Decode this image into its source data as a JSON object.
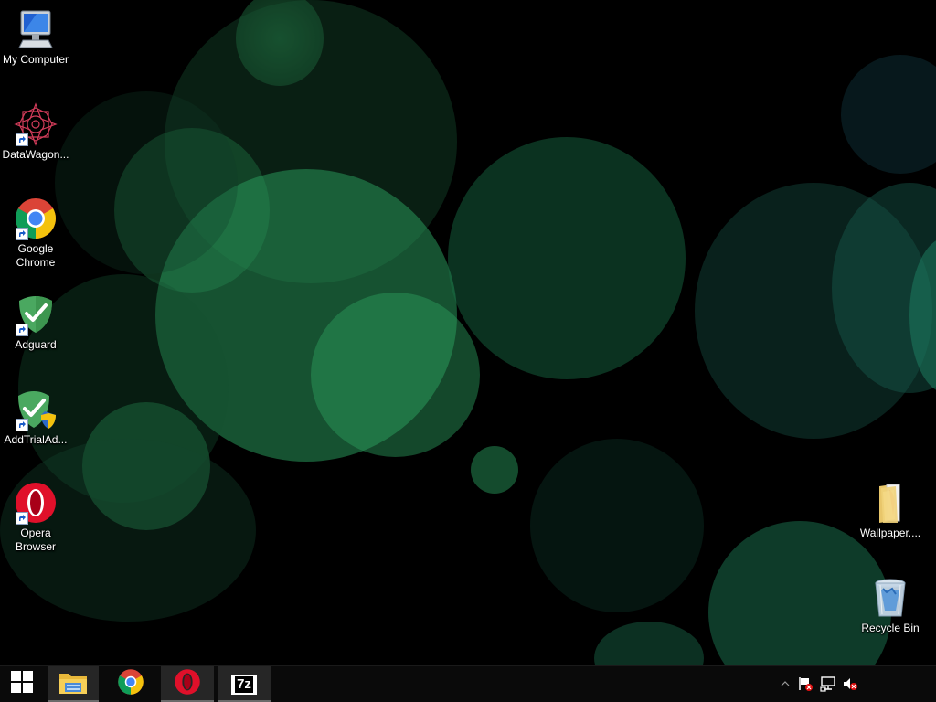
{
  "desktop": {
    "wallpaper": {
      "style": "green bokeh on black",
      "colors": [
        "#1f7a4a",
        "#2a9a5c",
        "#0f4a30",
        "#1a6a5a"
      ]
    },
    "icons_left": [
      {
        "label": "My Computer",
        "icon": "computer-icon",
        "shortcut": false
      },
      {
        "label": "DataWagon...",
        "icon": "datawagon-icon",
        "shortcut": true
      },
      {
        "label": "Google Chrome",
        "icon": "chrome-icon",
        "shortcut": true
      },
      {
        "label": "Adguard",
        "icon": "adguard-icon",
        "shortcut": true
      },
      {
        "label": "AddTrialAd...",
        "icon": "addtrial-icon",
        "shortcut": true
      },
      {
        "label": "Opera Browser",
        "icon": "opera-icon",
        "shortcut": true
      }
    ],
    "icons_right": [
      {
        "label": "Wallpaper....",
        "icon": "folder-icon",
        "shortcut": false
      },
      {
        "label": "Recycle Bin",
        "icon": "recycle-bin-icon",
        "shortcut": false
      }
    ]
  },
  "taskbar": {
    "start": {
      "icon": "windows-start-icon"
    },
    "apps": [
      {
        "icon": "file-explorer-icon",
        "pinned_active": true
      },
      {
        "icon": "chrome-icon",
        "pinned_active": false
      },
      {
        "icon": "opera-icon",
        "pinned_active": true
      },
      {
        "icon": "7zip-icon",
        "pinned_active": true,
        "text": "7z"
      }
    ],
    "tray": [
      {
        "icon": "show-hidden-icons-icon"
      },
      {
        "icon": "action-center-flag-icon"
      },
      {
        "icon": "network-icon"
      },
      {
        "icon": "volume-muted-icon"
      }
    ],
    "accent": "#ff0000"
  }
}
